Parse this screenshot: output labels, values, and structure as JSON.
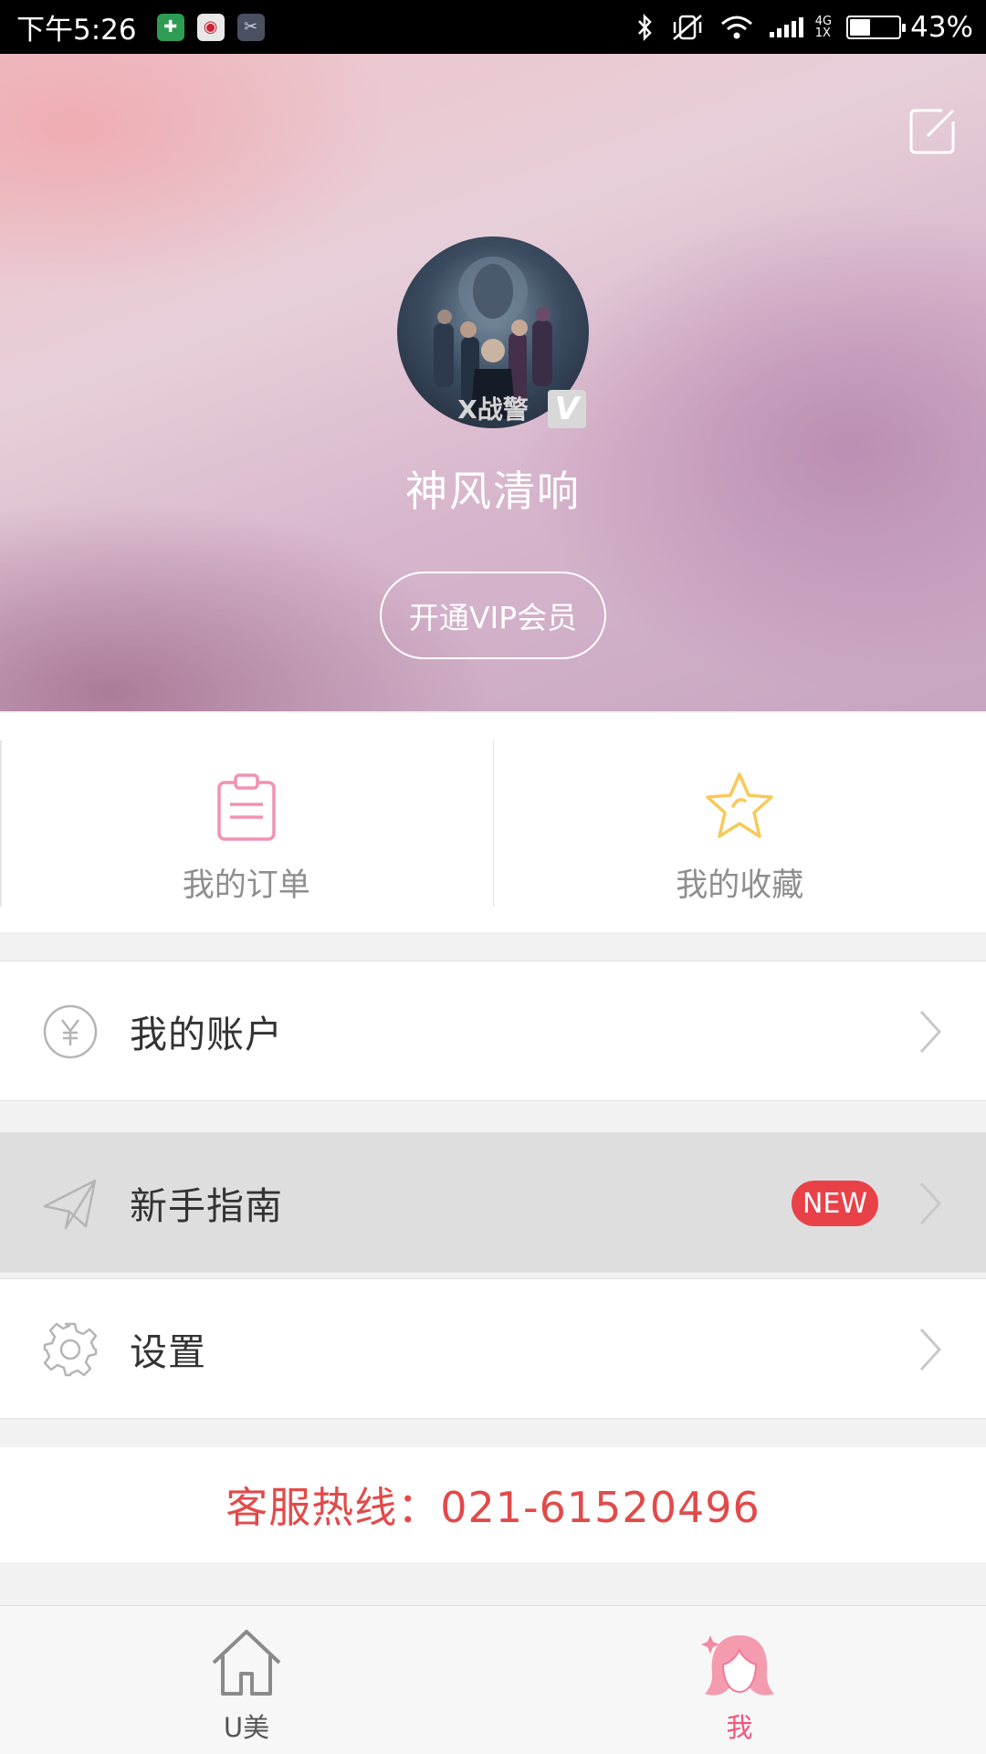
{
  "status_bar": {
    "time": "下午5:26",
    "network": [
      "4G",
      "1X"
    ],
    "battery_percent": "43%",
    "battery_level": 0.43
  },
  "profile": {
    "username": "神风清响",
    "vip_button": "开通VIP会员",
    "verified_badge": "V",
    "avatar_caption": "X战警"
  },
  "quick_actions": [
    {
      "label": "我的订单",
      "icon": "clipboard-icon",
      "color": "#f291b4"
    },
    {
      "label": "我的收藏",
      "icon": "star-icon",
      "color": "#f7c95a"
    }
  ],
  "menu": [
    {
      "label": "我的账户",
      "icon": "yen-icon"
    },
    {
      "label": "新手指南",
      "icon": "paper-plane-icon",
      "badge": "NEW",
      "highlighted": true
    },
    {
      "label": "设置",
      "icon": "gear-icon"
    }
  ],
  "hotline": "客服热线：021-61520496",
  "bottom_nav": [
    {
      "label": "U美",
      "icon": "home-icon",
      "active": false
    },
    {
      "label": "我",
      "icon": "girl-avatar-icon",
      "active": true
    }
  ],
  "colors": {
    "accent_pink": "#f0567e",
    "hotline_red": "#e24a4a",
    "badge_red": "#e94148"
  }
}
